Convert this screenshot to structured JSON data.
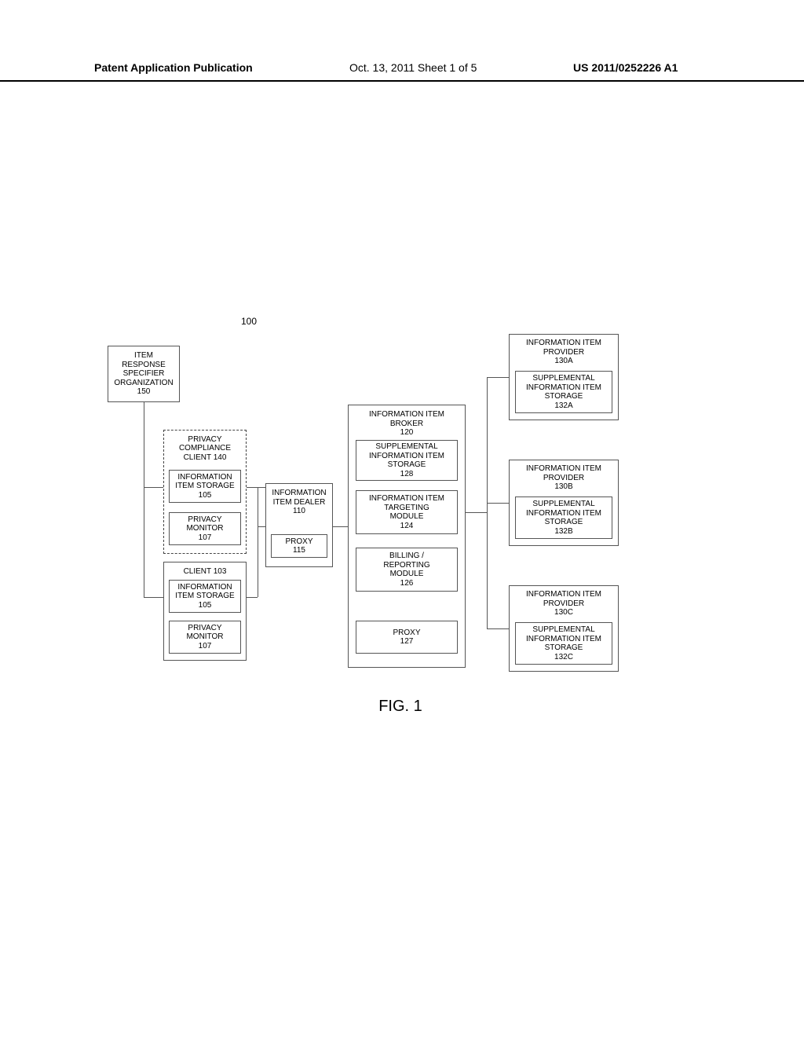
{
  "header": {
    "left": "Patent Application Publication",
    "center": "Oct. 13, 2011  Sheet 1 of 5",
    "right": "US 2011/0252226 A1"
  },
  "system_number": "100",
  "fig_label": "FIG. 1",
  "org150": {
    "l1": "ITEM",
    "l2": "RESPONSE",
    "l3": "SPECIFIER",
    "l4": "ORGANIZATION",
    "num": "150"
  },
  "client140": {
    "l1": "PRIVACY",
    "l2": "COMPLIANCE",
    "l3": "CLIENT 140"
  },
  "storage105a": {
    "l1": "INFORMATION",
    "l2": "ITEM STORAGE",
    "num": "105"
  },
  "monitor107a": {
    "l1": "PRIVACY",
    "l2": "MONITOR",
    "num": "107"
  },
  "client103": {
    "label": "CLIENT 103"
  },
  "storage105b": {
    "l1": "INFORMATION",
    "l2": "ITEM STORAGE",
    "num": "105"
  },
  "monitor107b": {
    "l1": "PRIVACY",
    "l2": "MONITOR",
    "num": "107"
  },
  "dealer110": {
    "l1": "INFORMATION",
    "l2": "ITEM DEALER",
    "num": "110"
  },
  "proxy115": {
    "l1": "PROXY",
    "num": "115"
  },
  "broker120": {
    "l1": "INFORMATION ITEM",
    "l2": "BROKER",
    "num": "120"
  },
  "storage128": {
    "l1": "SUPPLEMENTAL",
    "l2": "INFORMATION ITEM",
    "l3": "STORAGE",
    "num": "128"
  },
  "targeting124": {
    "l1": "INFORMATION ITEM",
    "l2": "TARGETING",
    "l3": "MODULE",
    "num": "124"
  },
  "billing126": {
    "l1": "BILLING /",
    "l2": "REPORTING",
    "l3": "MODULE",
    "num": "126"
  },
  "proxy127": {
    "l1": "PROXY",
    "num": "127"
  },
  "provider130a": {
    "l1": "INFORMATION ITEM",
    "l2": "PROVIDER",
    "num": "130A"
  },
  "storage132a": {
    "l1": "SUPPLEMENTAL",
    "l2": "INFORMATION ITEM",
    "l3": "STORAGE",
    "num": "132A"
  },
  "provider130b": {
    "l1": "INFORMATION ITEM",
    "l2": "PROVIDER",
    "num": "130B"
  },
  "storage132b": {
    "l1": "SUPPLEMENTAL",
    "l2": "INFORMATION ITEM",
    "l3": "STORAGE",
    "num": "132B"
  },
  "provider130c": {
    "l1": "INFORMATION ITEM",
    "l2": "PROVIDER",
    "num": "130C"
  },
  "storage132c": {
    "l1": "SUPPLEMENTAL",
    "l2": "INFORMATION ITEM",
    "l3": "STORAGE",
    "num": "132C"
  }
}
